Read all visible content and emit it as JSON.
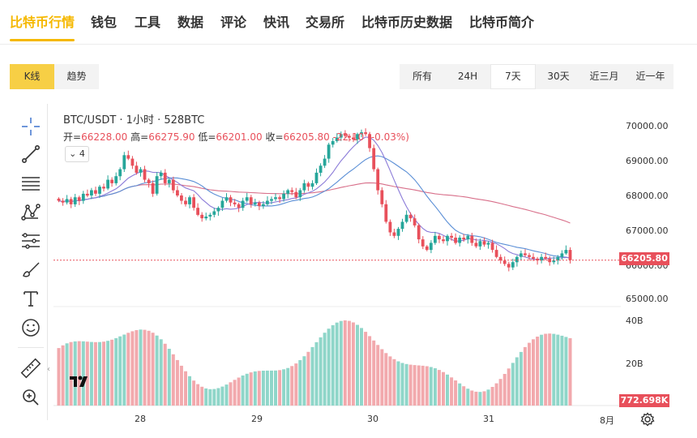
{
  "nav": {
    "items": [
      "比特币行情",
      "钱包",
      "工具",
      "数据",
      "评论",
      "快讯",
      "交易所",
      "比特币历史数据",
      "比特币简介"
    ],
    "active_index": 0,
    "accent_color": "#f5b800"
  },
  "chart_tabs": {
    "kline": "K线",
    "trend": "趋势",
    "active": "kline"
  },
  "ranges": {
    "items": [
      "所有",
      "24H",
      "7天",
      "30天",
      "近三月",
      "近一年"
    ],
    "selected": "7天"
  },
  "tools": [
    "crosshair-icon",
    "line-tool-icon",
    "horizontal-lines-icon",
    "pattern-icon",
    "fib-icon",
    "brush-icon",
    "text-icon",
    "emoji-icon",
    "ruler-icon",
    "zoom-in-icon"
  ],
  "legend": {
    "title": "BTC/USDT · 1小时 · 528BTC",
    "open_label": "开=",
    "open": "66228.00",
    "high_label": "高=",
    "high": "66275.90",
    "low_label": "低=",
    "low": "66201.00",
    "close_label": "收=",
    "close": "66205.80",
    "change": "-22.10 (-0.03%)",
    "indicator_count": "4"
  },
  "price_axis": [
    "70000.00",
    "69000.00",
    "68000.00",
    "67000.00",
    "66000.00",
    "65000.00"
  ],
  "volume_axis": [
    "40B",
    "20B"
  ],
  "current_price": "66205.80",
  "current_volume": "772.698K",
  "x_axis": [
    "28",
    "29",
    "30",
    "31",
    "8月"
  ],
  "colors": {
    "up": "#26a69a",
    "down": "#e8505b",
    "vol_up": "#8fd6c9",
    "vol_down": "#f2a9ad",
    "ma_fast": "#e8a33d",
    "ma_mid": "#8b7bd8",
    "ma_slow": "#5b8fd6",
    "ma_long": "#d86f8a"
  },
  "chart_data": {
    "type": "candlestick",
    "interval": "1h",
    "ylim": [
      65000,
      70200
    ],
    "series_close": [
      67900,
      67850,
      67950,
      67800,
      68000,
      67900,
      68100,
      68050,
      68200,
      68100,
      68300,
      68250,
      68500,
      68400,
      68600,
      68800,
      69200,
      69100,
      68900,
      68700,
      68800,
      68500,
      68400,
      68100,
      68600,
      68700,
      68400,
      68500,
      68200,
      68050,
      67900,
      67800,
      68000,
      67700,
      67500,
      67400,
      67450,
      67500,
      67600,
      67700,
      67900,
      68000,
      67850,
      67800,
      67700,
      67900,
      68000,
      67800,
      67850,
      67750,
      67800,
      67900,
      67950,
      68000,
      67950,
      68100,
      68200,
      68150,
      68000,
      68200,
      68400,
      68300,
      68400,
      68700,
      68900,
      69100,
      69500,
      69600,
      69700,
      69800,
      69750,
      69700,
      69650,
      69800,
      69850,
      69800,
      69400,
      68800,
      68200,
      67800,
      67300,
      67000,
      66900,
      67100,
      67300,
      67500,
      67400,
      67200,
      66800,
      66600,
      66500,
      66700,
      66900,
      66800,
      66750,
      66900,
      66850,
      66700,
      66850,
      66800,
      66900,
      66700,
      66600,
      66750,
      66650,
      66700,
      66500,
      66300,
      66200,
      66100,
      66000,
      66150,
      66300,
      66400,
      66350,
      66300,
      66250,
      66200,
      66300,
      66250,
      66150,
      66200,
      66300,
      66400,
      66500,
      66206
    ],
    "volume_ylim": [
      0,
      45
    ],
    "volume_unit": "B"
  }
}
